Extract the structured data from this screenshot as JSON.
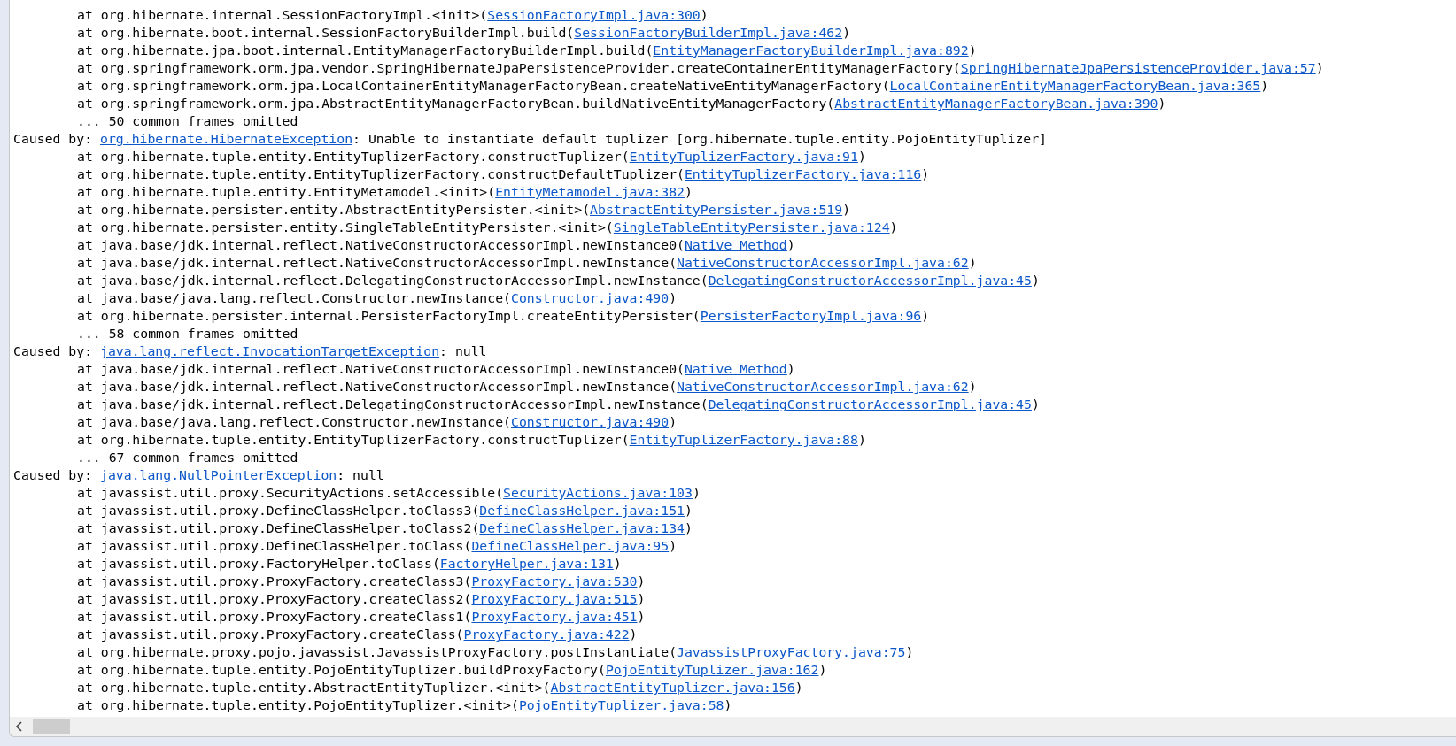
{
  "console": {
    "lines": [
      {
        "kind": "frame",
        "text": "at org.hibernate.internal.SessionFactoryImpl.<init>(",
        "link": "SessionFactoryImpl.java:300",
        "tail": ")"
      },
      {
        "kind": "frame",
        "text": "at org.hibernate.boot.internal.SessionFactoryBuilderImpl.build(",
        "link": "SessionFactoryBuilderImpl.java:462",
        "tail": ")"
      },
      {
        "kind": "frame",
        "text": "at org.hibernate.jpa.boot.internal.EntityManagerFactoryBuilderImpl.build(",
        "link": "EntityManagerFactoryBuilderImpl.java:892",
        "tail": ")"
      },
      {
        "kind": "frame",
        "text": "at org.springframework.orm.jpa.vendor.SpringHibernateJpaPersistenceProvider.createContainerEntityManagerFactory(",
        "link": "SpringHibernateJpaPersistenceProvider.java:57",
        "tail": ")"
      },
      {
        "kind": "frame",
        "text": "at org.springframework.orm.jpa.LocalContainerEntityManagerFactoryBean.createNativeEntityManagerFactory(",
        "link": "LocalContainerEntityManagerFactoryBean.java:365",
        "tail": ")"
      },
      {
        "kind": "frame",
        "text": "at org.springframework.orm.jpa.AbstractEntityManagerFactoryBean.buildNativeEntityManagerFactory(",
        "link": "AbstractEntityManagerFactoryBean.java:390",
        "tail": ")"
      },
      {
        "kind": "omitted",
        "text": "... 50 common frames omitted"
      },
      {
        "kind": "cause",
        "text": "Caused by: ",
        "link": "org.hibernate.HibernateException",
        "tail": ": Unable to instantiate default tuplizer [org.hibernate.tuple.entity.PojoEntityTuplizer]"
      },
      {
        "kind": "frame",
        "text": "at org.hibernate.tuple.entity.EntityTuplizerFactory.constructTuplizer(",
        "link": "EntityTuplizerFactory.java:91",
        "tail": ")"
      },
      {
        "kind": "frame",
        "text": "at org.hibernate.tuple.entity.EntityTuplizerFactory.constructDefaultTuplizer(",
        "link": "EntityTuplizerFactory.java:116",
        "tail": ")"
      },
      {
        "kind": "frame",
        "text": "at org.hibernate.tuple.entity.EntityMetamodel.<init>(",
        "link": "EntityMetamodel.java:382",
        "tail": ")"
      },
      {
        "kind": "frame",
        "text": "at org.hibernate.persister.entity.AbstractEntityPersister.<init>(",
        "link": "AbstractEntityPersister.java:519",
        "tail": ")"
      },
      {
        "kind": "frame",
        "text": "at org.hibernate.persister.entity.SingleTableEntityPersister.<init>(",
        "link": "SingleTableEntityPersister.java:124",
        "tail": ")"
      },
      {
        "kind": "frame",
        "text": "at java.base/jdk.internal.reflect.NativeConstructorAccessorImpl.newInstance0(",
        "link": "Native Method",
        "tail": ")"
      },
      {
        "kind": "frame",
        "text": "at java.base/jdk.internal.reflect.NativeConstructorAccessorImpl.newInstance(",
        "link": "NativeConstructorAccessorImpl.java:62",
        "tail": ")"
      },
      {
        "kind": "frame",
        "text": "at java.base/jdk.internal.reflect.DelegatingConstructorAccessorImpl.newInstance(",
        "link": "DelegatingConstructorAccessorImpl.java:45",
        "tail": ")"
      },
      {
        "kind": "frame",
        "text": "at java.base/java.lang.reflect.Constructor.newInstance(",
        "link": "Constructor.java:490",
        "tail": ")"
      },
      {
        "kind": "frame",
        "text": "at org.hibernate.persister.internal.PersisterFactoryImpl.createEntityPersister(",
        "link": "PersisterFactoryImpl.java:96",
        "tail": ")"
      },
      {
        "kind": "omitted",
        "text": "... 58 common frames omitted"
      },
      {
        "kind": "cause",
        "text": "Caused by: ",
        "link": "java.lang.reflect.InvocationTargetException",
        "tail": ": null"
      },
      {
        "kind": "frame",
        "text": "at java.base/jdk.internal.reflect.NativeConstructorAccessorImpl.newInstance0(",
        "link": "Native Method",
        "tail": ")"
      },
      {
        "kind": "frame",
        "text": "at java.base/jdk.internal.reflect.NativeConstructorAccessorImpl.newInstance(",
        "link": "NativeConstructorAccessorImpl.java:62",
        "tail": ")"
      },
      {
        "kind": "frame",
        "text": "at java.base/jdk.internal.reflect.DelegatingConstructorAccessorImpl.newInstance(",
        "link": "DelegatingConstructorAccessorImpl.java:45",
        "tail": ")"
      },
      {
        "kind": "frame",
        "text": "at java.base/java.lang.reflect.Constructor.newInstance(",
        "link": "Constructor.java:490",
        "tail": ")"
      },
      {
        "kind": "frame",
        "text": "at org.hibernate.tuple.entity.EntityTuplizerFactory.constructTuplizer(",
        "link": "EntityTuplizerFactory.java:88",
        "tail": ")"
      },
      {
        "kind": "omitted",
        "text": "... 67 common frames omitted"
      },
      {
        "kind": "cause",
        "text": "Caused by: ",
        "link": "java.lang.NullPointerException",
        "tail": ": null"
      },
      {
        "kind": "frame",
        "text": "at javassist.util.proxy.SecurityActions.setAccessible(",
        "link": "SecurityActions.java:103",
        "tail": ")"
      },
      {
        "kind": "frame",
        "text": "at javassist.util.proxy.DefineClassHelper.toClass3(",
        "link": "DefineClassHelper.java:151",
        "tail": ")"
      },
      {
        "kind": "frame",
        "text": "at javassist.util.proxy.DefineClassHelper.toClass2(",
        "link": "DefineClassHelper.java:134",
        "tail": ")"
      },
      {
        "kind": "frame",
        "text": "at javassist.util.proxy.DefineClassHelper.toClass(",
        "link": "DefineClassHelper.java:95",
        "tail": ")"
      },
      {
        "kind": "frame",
        "text": "at javassist.util.proxy.FactoryHelper.toClass(",
        "link": "FactoryHelper.java:131",
        "tail": ")"
      },
      {
        "kind": "frame",
        "text": "at javassist.util.proxy.ProxyFactory.createClass3(",
        "link": "ProxyFactory.java:530",
        "tail": ")"
      },
      {
        "kind": "frame",
        "text": "at javassist.util.proxy.ProxyFactory.createClass2(",
        "link": "ProxyFactory.java:515",
        "tail": ")"
      },
      {
        "kind": "frame",
        "text": "at javassist.util.proxy.ProxyFactory.createClass1(",
        "link": "ProxyFactory.java:451",
        "tail": ")"
      },
      {
        "kind": "frame",
        "text": "at javassist.util.proxy.ProxyFactory.createClass(",
        "link": "ProxyFactory.java:422",
        "tail": ")"
      },
      {
        "kind": "frame",
        "text": "at org.hibernate.proxy.pojo.javassist.JavassistProxyFactory.postInstantiate(",
        "link": "JavassistProxyFactory.java:75",
        "tail": ")"
      },
      {
        "kind": "frame",
        "text": "at org.hibernate.tuple.entity.PojoEntityTuplizer.buildProxyFactory(",
        "link": "PojoEntityTuplizer.java:162",
        "tail": ")"
      },
      {
        "kind": "frame",
        "text": "at org.hibernate.tuple.entity.AbstractEntityTuplizer.<init>(",
        "link": "AbstractEntityTuplizer.java:156",
        "tail": ")"
      },
      {
        "kind": "frame",
        "text": "at org.hibernate.tuple.entity.PojoEntityTuplizer.<init>(",
        "link": "PojoEntityTuplizer.java:58",
        "tail": ")"
      }
    ]
  }
}
